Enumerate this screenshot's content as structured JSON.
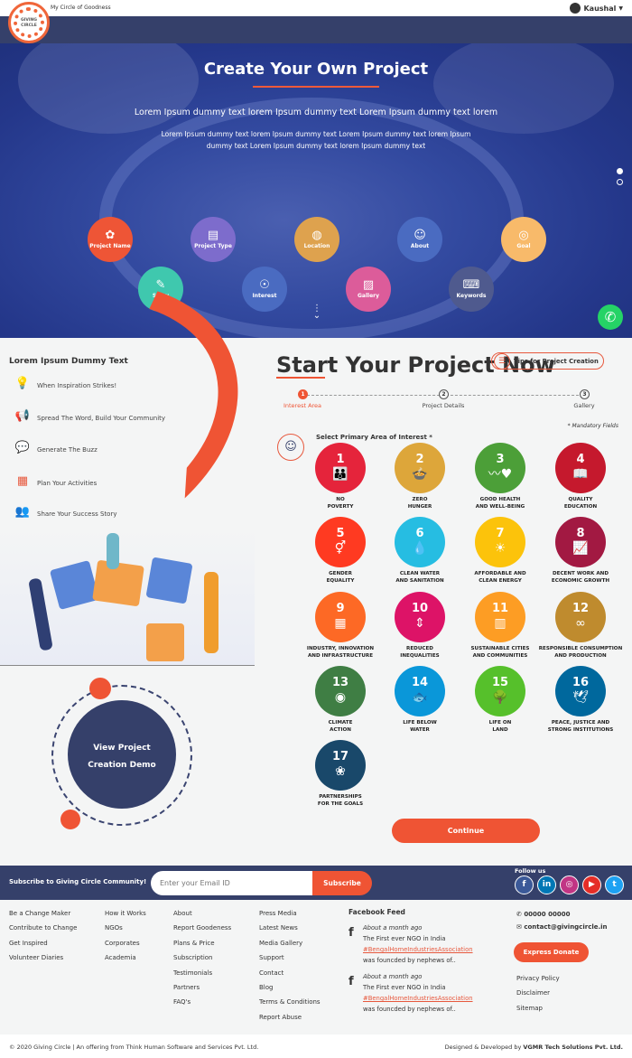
{
  "header": {
    "tagline": "My Circle of Goodness",
    "user": "Kaushal",
    "logo_text": "GIVING CIRCLE"
  },
  "hero": {
    "title": "Create Your Own Project",
    "subtitle": "Lorem Ipsum dummy text lorem Ipsum dummy text Lorem Ipsum dummy text lorem",
    "description": "Lorem Ipsum dummy text lorem Ipsum dummy text Lorem Ipsum dummy text lorem Ipsum dummy text Lorem Ipsum dummy text lorem Ipsum dummy text",
    "items": [
      {
        "label": "Project Name",
        "icon": "lightbulb-gear",
        "color": "#ee5536"
      },
      {
        "label": "Project Type",
        "icon": "document",
        "color": "#7d6ccc"
      },
      {
        "label": "Location",
        "icon": "globe",
        "color": "#dea24e"
      },
      {
        "label": "About",
        "icon": "user",
        "color": "#4a6bc1"
      },
      {
        "label": "Goal",
        "icon": "target",
        "color": "#f8ba6a"
      },
      {
        "label": "Story",
        "icon": "edit-document",
        "color": "#3fc8ae"
      },
      {
        "label": "Interest",
        "icon": "brain-head",
        "color": "#4a6bc1"
      },
      {
        "label": "Gallery",
        "icon": "image",
        "color": "#dc5c9a"
      },
      {
        "label": "Keywords",
        "icon": "keyboard",
        "color": "#4f5a8e"
      }
    ]
  },
  "left": {
    "heading": "Lorem Ipsum Dummy Text",
    "steps": [
      {
        "label": "When Inspiration Strikes!",
        "icon": "lightbulb-icon"
      },
      {
        "label": "Spread The Word, Build Your Community",
        "icon": "megaphone-icon"
      },
      {
        "label": "Generate The Buzz",
        "icon": "chat-icon"
      },
      {
        "label": "Plan Your Activities",
        "icon": "calendar-icon"
      },
      {
        "label": "Share Your Success Story",
        "icon": "people-icon"
      }
    ],
    "demo": "View Project Creation Demo"
  },
  "main": {
    "title": "Start Your Project Now",
    "tips": "Tips for Project Creation",
    "progress": [
      {
        "n": "1",
        "label": "Interest Area",
        "active": true
      },
      {
        "n": "2",
        "label": "Project Details"
      },
      {
        "n": "3",
        "label": "Gallery"
      }
    ],
    "mandatory": "* Mandatory Fields",
    "select_label": "Select Primary Area of Interest *",
    "continue": "Continue",
    "goals": [
      {
        "n": "1",
        "l1": "NO",
        "l2": "POVERTY",
        "color": "#e5243b",
        "g": "👪"
      },
      {
        "n": "2",
        "l1": "ZERO",
        "l2": "HUNGER",
        "color": "#dda63a",
        "g": "🍲"
      },
      {
        "n": "3",
        "l1": "GOOD HEALTH",
        "l2": "AND WELL-BEING",
        "color": "#4c9f38",
        "g": "〰♥"
      },
      {
        "n": "4",
        "l1": "QUALITY",
        "l2": "EDUCATION",
        "color": "#c5192d",
        "g": "📖"
      },
      {
        "n": "5",
        "l1": "GENDER",
        "l2": "EQUALITY",
        "color": "#ff3a21",
        "g": "⚥"
      },
      {
        "n": "6",
        "l1": "CLEAN WATER",
        "l2": "AND SANITATION",
        "color": "#26bde2",
        "g": "💧"
      },
      {
        "n": "7",
        "l1": "AFFORDABLE AND",
        "l2": "CLEAN ENERGY",
        "color": "#fcc30b",
        "g": "☀"
      },
      {
        "n": "8",
        "l1": "DECENT WORK AND",
        "l2": "ECONOMIC GROWTH",
        "color": "#a21942",
        "g": "📈"
      },
      {
        "n": "9",
        "l1": "INDUSTRY, INNOVATION",
        "l2": "AND INFRASTRUCTURE",
        "color": "#fd6925",
        "g": "▦"
      },
      {
        "n": "10",
        "l1": "REDUCED",
        "l2": "INEQUALITIES",
        "color": "#dd1367",
        "g": "⇕"
      },
      {
        "n": "11",
        "l1": "SUSTAINABLE CITIES",
        "l2": "AND COMMUNITIES",
        "color": "#fd9d24",
        "g": "▥"
      },
      {
        "n": "12",
        "l1": "RESPONSIBLE CONSUMPTION",
        "l2": "AND PRODUCTION",
        "color": "#bf8b2e",
        "g": "∞"
      },
      {
        "n": "13",
        "l1": "CLIMATE",
        "l2": "ACTION",
        "color": "#3f7e44",
        "g": "◉"
      },
      {
        "n": "14",
        "l1": "LIFE BELOW",
        "l2": "WATER",
        "color": "#0a97d9",
        "g": "🐟"
      },
      {
        "n": "15",
        "l1": "LIFE ON",
        "l2": "LAND",
        "color": "#56c02b",
        "g": "🌳"
      },
      {
        "n": "16",
        "l1": "PEACE, JUSTICE AND",
        "l2": "STRONG INSTITUTIONS",
        "color": "#00689d",
        "g": "🕊"
      },
      {
        "n": "17",
        "l1": "PARTNERSHIPS",
        "l2": "FOR THE GOALS",
        "color": "#19486a",
        "g": "❀"
      }
    ]
  },
  "footer": {
    "subscribe_text": "Subscribe to Giving Circle Community!",
    "email_placeholder": "Enter your Email ID",
    "subscribe": "Subscribe",
    "follow": "Follow us",
    "social": [
      {
        "name": "facebook",
        "g": "f",
        "color": "#3b5998"
      },
      {
        "name": "linkedin",
        "g": "in",
        "color": "#0077b5"
      },
      {
        "name": "instagram",
        "g": "◎",
        "color": "#c13584"
      },
      {
        "name": "youtube",
        "g": "▶",
        "color": "#e52d27"
      },
      {
        "name": "twitter",
        "g": "t",
        "color": "#1da1f2"
      }
    ],
    "col1": [
      "Be a Change Maker",
      "Contribute to Change",
      "Get Inspired",
      "Volunteer Diaries"
    ],
    "col2": [
      "How it Works",
      "NGOs",
      "Corporates",
      "Academia"
    ],
    "col3": [
      "About",
      "Report Goodeness",
      "Plans & Price",
      "Subscription",
      "Testimonials",
      "Partners",
      "FAQ's"
    ],
    "col4": [
      "Press Media",
      "Latest News",
      "Media Gallery",
      "Support",
      "Contact",
      "Blog",
      "Terms & Conditions",
      "Report Abuse"
    ],
    "feed_title": "Facebook Feed",
    "feed": [
      {
        "time": "About a month ago",
        "text": "The First ever NGO in India",
        "tag": "#BengalHomeIndustriesAssociation",
        "more": "was founcded by nephews of.."
      },
      {
        "time": "About a month ago",
        "text": "The First ever NGO in India",
        "tag": "#BengalHomeIndustriesAssociation",
        "more": "was founcded by nephews of.."
      }
    ],
    "phone": "00000 00000",
    "email": "contact@givingcircle.in",
    "donate": "Express Donate",
    "legal": [
      "Privacy Policy",
      "Disclaimer",
      "Sitemap"
    ],
    "copyright": "© 2020 Giving Circle | An offering from Think Human Software and Services Pvt. Ltd.",
    "credit_prefix": "Designed & Developed by",
    "credit": "VGMR Tech Solutions Pvt. Ltd."
  }
}
